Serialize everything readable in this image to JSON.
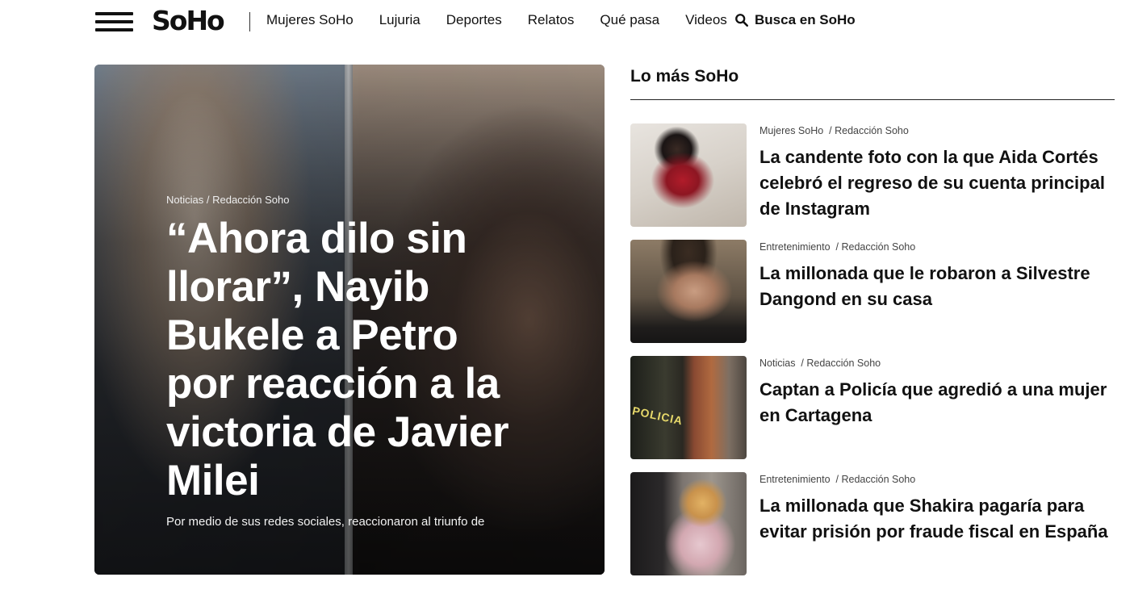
{
  "header": {
    "logo": "SoHo",
    "nav": [
      {
        "label": "Mujeres SoHo"
      },
      {
        "label": "Lujuria"
      },
      {
        "label": "Deportes"
      },
      {
        "label": "Relatos"
      },
      {
        "label": "Qué pasa"
      },
      {
        "label": "Videos"
      }
    ],
    "search_label": "Busca en SoHo"
  },
  "hero": {
    "category": "Noticias",
    "author": "Redacción Soho",
    "title": "“Ahora dilo sin llorar”, Nayib Bukele a Petro por reacción a la victoria de Javier Milei",
    "summary": "Por medio de sus redes sociales, reaccionaron al triunfo de"
  },
  "sidebar": {
    "title": "Lo más SoHo",
    "items": [
      {
        "category": "Mujeres SoHo",
        "author": "Redacción Soho",
        "title": "La candente foto con la que Aida Cortés celebró el regreso de su cuenta principal de Instagram"
      },
      {
        "category": "Entretenimiento",
        "author": "Redacción Soho",
        "title": "La millonada que le robaron a Silvestre Dangond en su casa"
      },
      {
        "category": "Noticias",
        "author": "Redacción Soho",
        "title": "Captan a Policía que agredió a una mujer en Cartagena",
        "thumb_text": "POLICIA"
      },
      {
        "category": "Entretenimiento",
        "author": "Redacción Soho",
        "title": "La millonada que Shakira pagaría para evitar prisión por fraude fiscal en España"
      }
    ]
  }
}
